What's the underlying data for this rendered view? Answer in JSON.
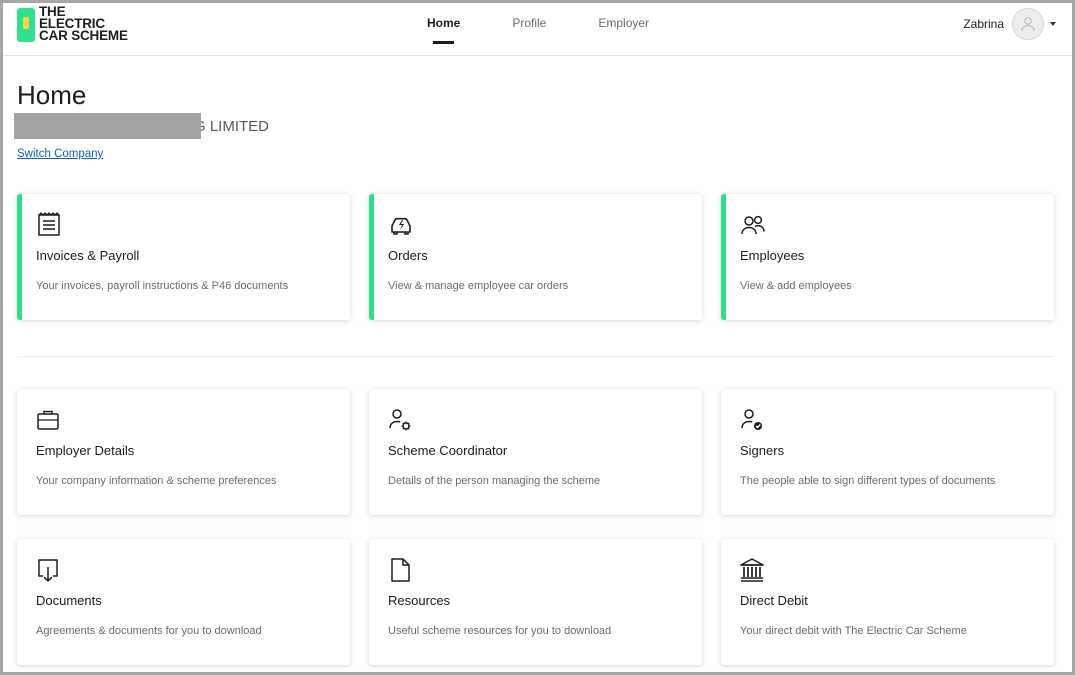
{
  "brand": {
    "line1": "THE",
    "line2": "ELECTRIC",
    "line3": "CAR SCHEME",
    "accent": "#2fe08c",
    "accent2": "#f6d44b"
  },
  "nav": {
    "items": [
      {
        "label": "Home"
      },
      {
        "label": "Profile"
      },
      {
        "label": "Employer"
      }
    ],
    "active": "Home"
  },
  "user": {
    "name": "Zabrina"
  },
  "page": {
    "title": "Home",
    "company_visible": "G LIMITED",
    "switch_label": "Switch Company"
  },
  "primary_cards": [
    {
      "icon": "receipt-icon",
      "title": "Invoices & Payroll",
      "desc": "Your invoices, payroll instructions & P46 documents"
    },
    {
      "icon": "electric-car-icon",
      "title": "Orders",
      "desc": "View & manage employee car orders"
    },
    {
      "icon": "users-icon",
      "title": "Employees",
      "desc": "View & add employees"
    }
  ],
  "secondary_cards": [
    {
      "icon": "briefcase-icon",
      "title": "Employer Details",
      "desc": "Your company information & scheme preferences"
    },
    {
      "icon": "user-gear-icon",
      "title": "Scheme Coordinator",
      "desc": "Details of the person managing the scheme"
    },
    {
      "icon": "user-check-icon",
      "title": "Signers",
      "desc": "The people able to sign different types of documents"
    },
    {
      "icon": "download-document-icon",
      "title": "Documents",
      "desc": "Agreements & documents for you to download"
    },
    {
      "icon": "file-icon",
      "title": "Resources",
      "desc": "Useful scheme resources for you to download"
    },
    {
      "icon": "bank-icon",
      "title": "Direct Debit",
      "desc": "Your direct debit with The Electric Car Scheme"
    }
  ],
  "colors": {
    "card_accent": "#31dd8a",
    "link": "#1560bd"
  }
}
